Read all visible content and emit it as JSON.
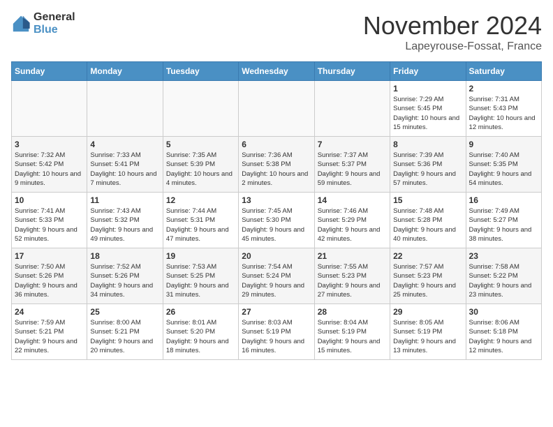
{
  "logo": {
    "line1": "General",
    "line2": "Blue"
  },
  "title": "November 2024",
  "location": "Lapeyrouse-Fossat, France",
  "days_header": [
    "Sunday",
    "Monday",
    "Tuesday",
    "Wednesday",
    "Thursday",
    "Friday",
    "Saturday"
  ],
  "weeks": [
    [
      {
        "num": "",
        "info": ""
      },
      {
        "num": "",
        "info": ""
      },
      {
        "num": "",
        "info": ""
      },
      {
        "num": "",
        "info": ""
      },
      {
        "num": "",
        "info": ""
      },
      {
        "num": "1",
        "info": "Sunrise: 7:29 AM\nSunset: 5:45 PM\nDaylight: 10 hours and 15 minutes."
      },
      {
        "num": "2",
        "info": "Sunrise: 7:31 AM\nSunset: 5:43 PM\nDaylight: 10 hours and 12 minutes."
      }
    ],
    [
      {
        "num": "3",
        "info": "Sunrise: 7:32 AM\nSunset: 5:42 PM\nDaylight: 10 hours and 9 minutes."
      },
      {
        "num": "4",
        "info": "Sunrise: 7:33 AM\nSunset: 5:41 PM\nDaylight: 10 hours and 7 minutes."
      },
      {
        "num": "5",
        "info": "Sunrise: 7:35 AM\nSunset: 5:39 PM\nDaylight: 10 hours and 4 minutes."
      },
      {
        "num": "6",
        "info": "Sunrise: 7:36 AM\nSunset: 5:38 PM\nDaylight: 10 hours and 2 minutes."
      },
      {
        "num": "7",
        "info": "Sunrise: 7:37 AM\nSunset: 5:37 PM\nDaylight: 9 hours and 59 minutes."
      },
      {
        "num": "8",
        "info": "Sunrise: 7:39 AM\nSunset: 5:36 PM\nDaylight: 9 hours and 57 minutes."
      },
      {
        "num": "9",
        "info": "Sunrise: 7:40 AM\nSunset: 5:35 PM\nDaylight: 9 hours and 54 minutes."
      }
    ],
    [
      {
        "num": "10",
        "info": "Sunrise: 7:41 AM\nSunset: 5:33 PM\nDaylight: 9 hours and 52 minutes."
      },
      {
        "num": "11",
        "info": "Sunrise: 7:43 AM\nSunset: 5:32 PM\nDaylight: 9 hours and 49 minutes."
      },
      {
        "num": "12",
        "info": "Sunrise: 7:44 AM\nSunset: 5:31 PM\nDaylight: 9 hours and 47 minutes."
      },
      {
        "num": "13",
        "info": "Sunrise: 7:45 AM\nSunset: 5:30 PM\nDaylight: 9 hours and 45 minutes."
      },
      {
        "num": "14",
        "info": "Sunrise: 7:46 AM\nSunset: 5:29 PM\nDaylight: 9 hours and 42 minutes."
      },
      {
        "num": "15",
        "info": "Sunrise: 7:48 AM\nSunset: 5:28 PM\nDaylight: 9 hours and 40 minutes."
      },
      {
        "num": "16",
        "info": "Sunrise: 7:49 AM\nSunset: 5:27 PM\nDaylight: 9 hours and 38 minutes."
      }
    ],
    [
      {
        "num": "17",
        "info": "Sunrise: 7:50 AM\nSunset: 5:26 PM\nDaylight: 9 hours and 36 minutes."
      },
      {
        "num": "18",
        "info": "Sunrise: 7:52 AM\nSunset: 5:26 PM\nDaylight: 9 hours and 34 minutes."
      },
      {
        "num": "19",
        "info": "Sunrise: 7:53 AM\nSunset: 5:25 PM\nDaylight: 9 hours and 31 minutes."
      },
      {
        "num": "20",
        "info": "Sunrise: 7:54 AM\nSunset: 5:24 PM\nDaylight: 9 hours and 29 minutes."
      },
      {
        "num": "21",
        "info": "Sunrise: 7:55 AM\nSunset: 5:23 PM\nDaylight: 9 hours and 27 minutes."
      },
      {
        "num": "22",
        "info": "Sunrise: 7:57 AM\nSunset: 5:23 PM\nDaylight: 9 hours and 25 minutes."
      },
      {
        "num": "23",
        "info": "Sunrise: 7:58 AM\nSunset: 5:22 PM\nDaylight: 9 hours and 23 minutes."
      }
    ],
    [
      {
        "num": "24",
        "info": "Sunrise: 7:59 AM\nSunset: 5:21 PM\nDaylight: 9 hours and 22 minutes."
      },
      {
        "num": "25",
        "info": "Sunrise: 8:00 AM\nSunset: 5:21 PM\nDaylight: 9 hours and 20 minutes."
      },
      {
        "num": "26",
        "info": "Sunrise: 8:01 AM\nSunset: 5:20 PM\nDaylight: 9 hours and 18 minutes."
      },
      {
        "num": "27",
        "info": "Sunrise: 8:03 AM\nSunset: 5:19 PM\nDaylight: 9 hours and 16 minutes."
      },
      {
        "num": "28",
        "info": "Sunrise: 8:04 AM\nSunset: 5:19 PM\nDaylight: 9 hours and 15 minutes."
      },
      {
        "num": "29",
        "info": "Sunrise: 8:05 AM\nSunset: 5:19 PM\nDaylight: 9 hours and 13 minutes."
      },
      {
        "num": "30",
        "info": "Sunrise: 8:06 AM\nSunset: 5:18 PM\nDaylight: 9 hours and 12 minutes."
      }
    ]
  ]
}
